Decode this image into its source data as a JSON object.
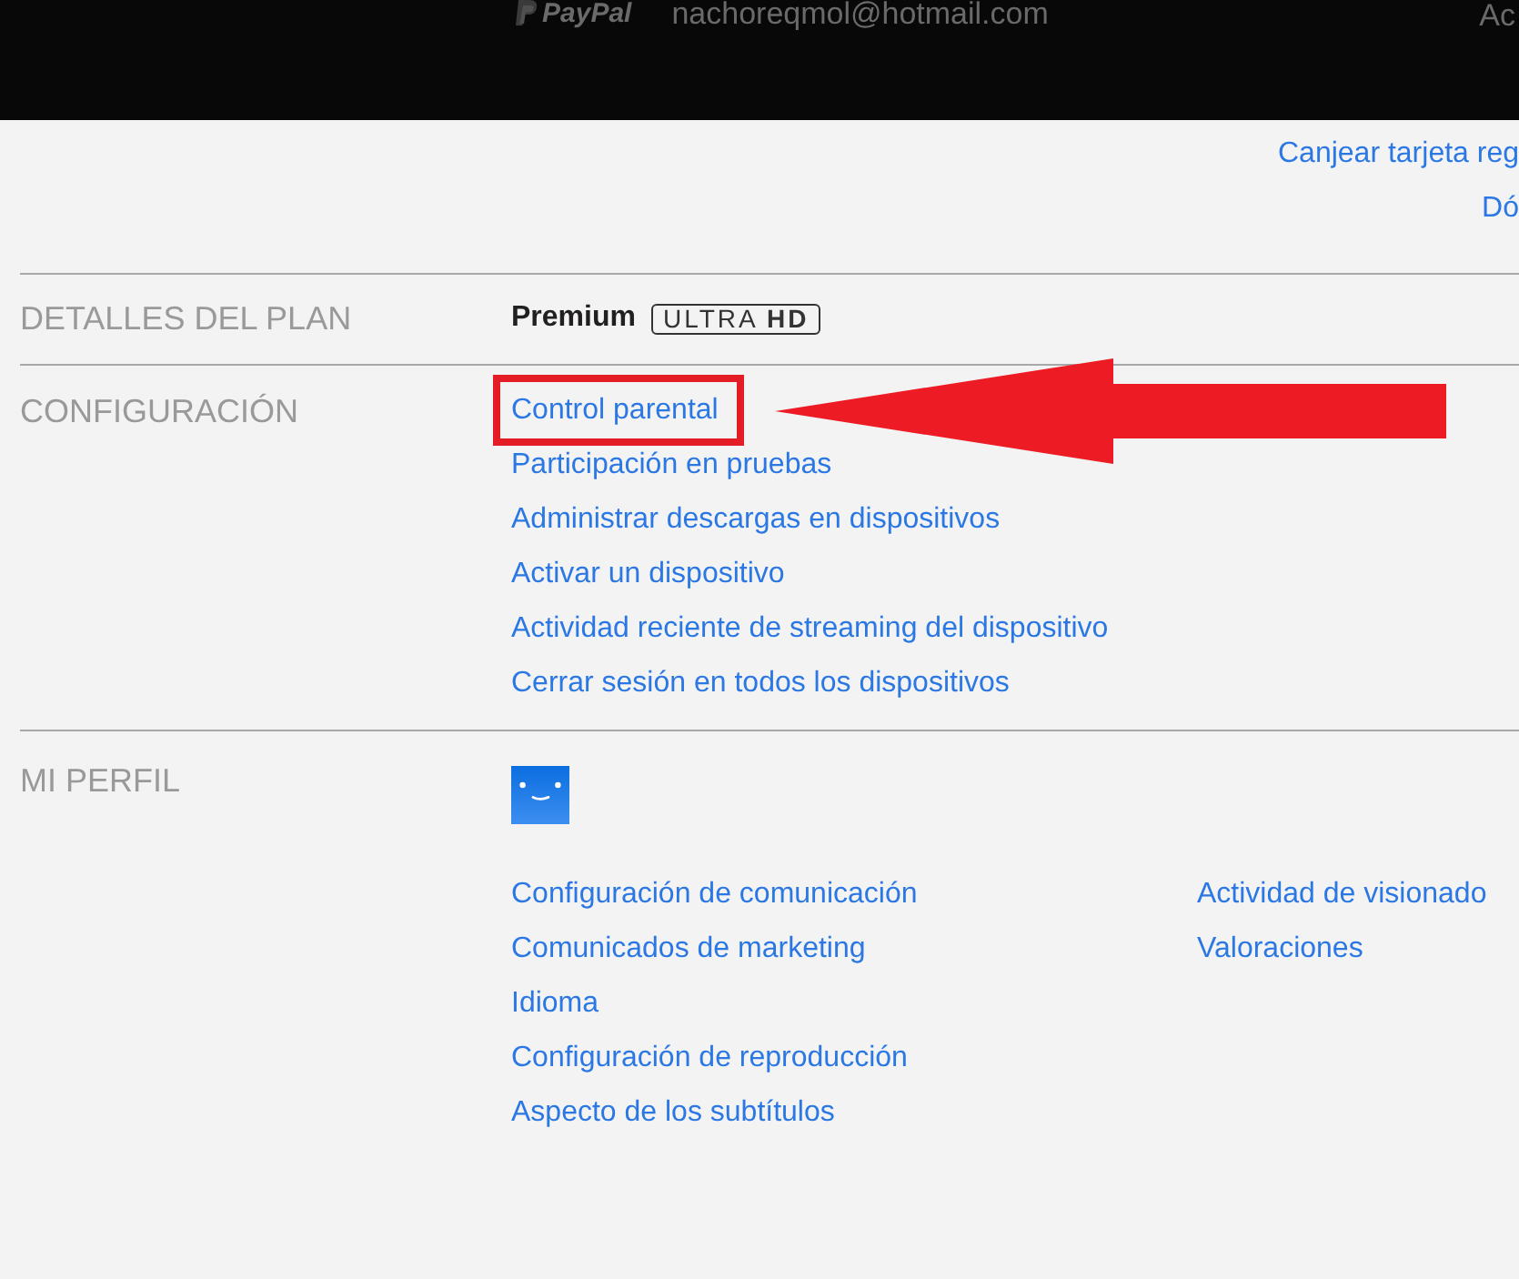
{
  "top_bar": {
    "payment_label": "PayPal",
    "email": "nachoreqmol@hotmail.com",
    "link": "Ac"
  },
  "top_links": [
    "Canjear tarjeta reg",
    "Dó"
  ],
  "sections": [
    {
      "kind": "plan",
      "label": "DETALLES DEL PLAN",
      "plan": "Premium",
      "badge": "ULTRA **HD**"
    },
    {
      "kind": "links",
      "label": "CONFIGURACIÓN",
      "links": [
        {
          "text": "Control parental",
          "highlighted": true
        },
        {
          "text": "Participación en pruebas",
          "highlighted": false
        },
        {
          "text": "Administrar descargas en dispositivos",
          "highlighted": false
        },
        {
          "text": "Activar un dispositivo",
          "highlighted": false
        },
        {
          "text": "Actividad reciente de streaming del dispositivo",
          "highlighted": false
        },
        {
          "text": "Cerrar sesión en todos los dispositivos",
          "highlighted": false
        }
      ]
    },
    {
      "kind": "profile",
      "label": "MI PERFIL",
      "columns": [
        {
          "links": [
            "Configuración de comunicación",
            "Comunicados de marketing",
            "Idioma",
            "Configuración de reproducción",
            "Aspecto de los subtítulos"
          ]
        },
        {
          "links": [
            "Actividad de visionado",
            "Valoraciones"
          ]
        }
      ]
    }
  ]
}
